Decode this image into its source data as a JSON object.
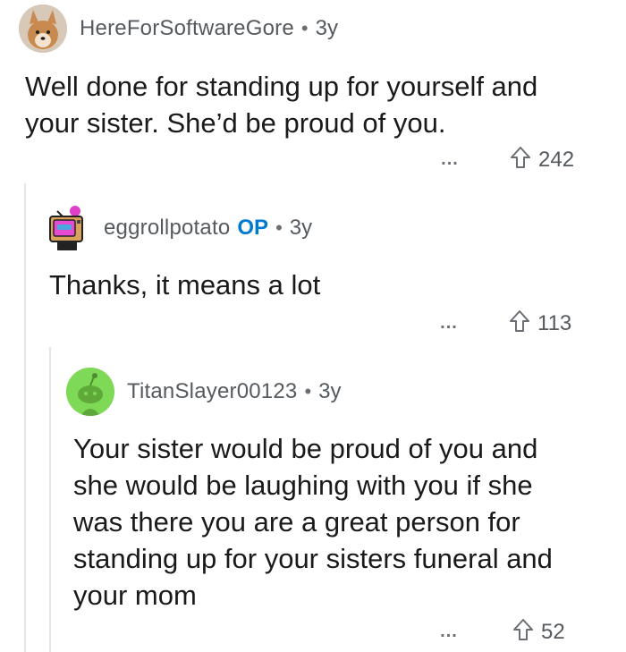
{
  "comments": [
    {
      "username": "HereForSoftwareGore",
      "op_badge": "",
      "separator": "•",
      "age": "3y",
      "avatar_icon": "dog-avatar-icon",
      "body_lines": [
        "Well done for standing up for yourself and",
        "your sister. She’d be proud of you."
      ],
      "more_label": "...",
      "upvotes": "242"
    },
    {
      "username": "eggrollpotato",
      "op_badge": "OP",
      "separator": "•",
      "age": "3y",
      "avatar_icon": "robot-tv-avatar-icon",
      "body_lines": [
        "Thanks, it means a lot"
      ],
      "more_label": "...",
      "upvotes": "113"
    },
    {
      "username": "TitanSlayer00123",
      "op_badge": "",
      "separator": "•",
      "age": "3y",
      "avatar_icon": "snoo-avatar-icon",
      "body_lines": [
        "Your sister would be proud of you and",
        "she would be laughing with you if she",
        "was there you are a great person for",
        "standing up for your sisters funeral and",
        "your mom"
      ],
      "more_label": "...",
      "upvotes": "52"
    }
  ],
  "colors": {
    "op_blue": "#0079d3",
    "snoo_bg": "#7ed957",
    "thread_line": "#e4e6e8"
  }
}
